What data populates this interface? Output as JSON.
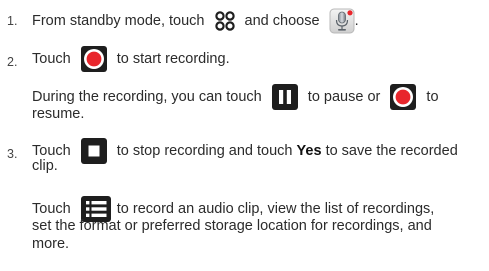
{
  "steps": [
    {
      "number": "1.",
      "parts": {
        "a": "From standby mode, touch",
        "b": "and choose",
        "c": "."
      }
    },
    {
      "number": "2.",
      "line1": {
        "a": "Touch",
        "b": "to start recording."
      },
      "line2": {
        "a": "During the recording, you can touch",
        "b": "to pause or",
        "c": "to"
      },
      "line3": "resume."
    },
    {
      "number": "3.",
      "line1": {
        "a": "Touch",
        "b": "to stop recording and touch",
        "yes": "Yes",
        "c": "to save the recorded"
      },
      "line2": "clip.",
      "line3": {
        "a": "Touch",
        "b": "to record an audio clip, view the list of recordings,"
      },
      "line4": "set the format or preferred storage location for recordings, and",
      "line5": "more."
    }
  ],
  "icons": {
    "apps": "apps-grid-icon",
    "recorder": "voice-recorder-app-icon",
    "record": "record-button-icon",
    "pause": "pause-button-icon",
    "stop": "stop-button-icon",
    "menu": "menu-list-icon"
  },
  "colors": {
    "text": "#2b2b2b",
    "record_red": "#e8262c",
    "icon_dark": "#1e1e1e"
  }
}
